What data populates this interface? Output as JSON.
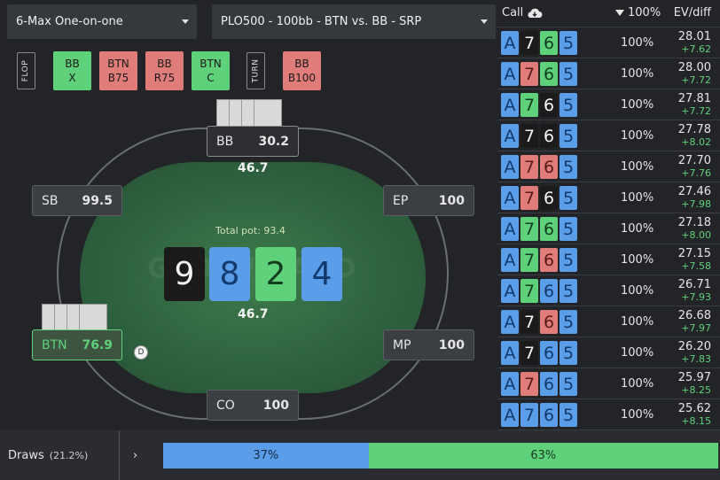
{
  "dropdowns": {
    "format": "6-Max One-on-one",
    "scenario": "PLO500 - 100bb - BTN vs. BB - SRP"
  },
  "actions": {
    "flop_label": "FLOP",
    "turn_label": "TURN",
    "flop_actions": [
      {
        "player": "BB",
        "action": "X",
        "color": "green"
      },
      {
        "player": "BTN",
        "action": "B75",
        "color": "red"
      },
      {
        "player": "BB",
        "action": "R75",
        "color": "red"
      },
      {
        "player": "BTN",
        "action": "C",
        "color": "green"
      }
    ],
    "turn_actions": [
      {
        "player": "BB",
        "action": "B100",
        "color": "red"
      }
    ]
  },
  "table": {
    "total_pot": "Total pot: 93.4",
    "watermark": "GTO WIZARD",
    "bb_bet": "46.7",
    "btn_bet": "46.7",
    "board": [
      {
        "rank": "9",
        "color": "black"
      },
      {
        "rank": "8",
        "color": "blue"
      },
      {
        "rank": "2",
        "color": "green"
      },
      {
        "rank": "4",
        "color": "blue"
      }
    ],
    "seats": {
      "bb": {
        "name": "BB",
        "stack": "30.2"
      },
      "sb": {
        "name": "SB",
        "stack": "99.5"
      },
      "ep": {
        "name": "EP",
        "stack": "100"
      },
      "btn": {
        "name": "BTN",
        "stack": "76.9"
      },
      "mp": {
        "name": "MP",
        "stack": "100"
      },
      "co": {
        "name": "CO",
        "stack": "100"
      }
    },
    "dealer": "D"
  },
  "panel": {
    "header": {
      "action": "Call",
      "sort_label": "100%",
      "ev_label": "EV/diff"
    },
    "rows": [
      {
        "cards": [
          [
            "A",
            "blue"
          ],
          [
            "7",
            "black"
          ],
          [
            "6",
            "green"
          ],
          [
            "5",
            "blue"
          ]
        ],
        "pct": "100%",
        "ev": "28.01",
        "diff": "+7.62"
      },
      {
        "cards": [
          [
            "A",
            "blue"
          ],
          [
            "7",
            "red"
          ],
          [
            "6",
            "green"
          ],
          [
            "5",
            "blue"
          ]
        ],
        "pct": "100%",
        "ev": "28.00",
        "diff": "+7.72"
      },
      {
        "cards": [
          [
            "A",
            "blue"
          ],
          [
            "7",
            "green"
          ],
          [
            "6",
            "black"
          ],
          [
            "5",
            "blue"
          ]
        ],
        "pct": "100%",
        "ev": "27.81",
        "diff": "+7.72"
      },
      {
        "cards": [
          [
            "A",
            "blue"
          ],
          [
            "7",
            "black"
          ],
          [
            "6",
            "black"
          ],
          [
            "5",
            "blue"
          ]
        ],
        "pct": "100%",
        "ev": "27.78",
        "diff": "+8.02"
      },
      {
        "cards": [
          [
            "A",
            "blue"
          ],
          [
            "7",
            "red"
          ],
          [
            "6",
            "red"
          ],
          [
            "5",
            "blue"
          ]
        ],
        "pct": "100%",
        "ev": "27.70",
        "diff": "+7.76"
      },
      {
        "cards": [
          [
            "A",
            "blue"
          ],
          [
            "7",
            "red"
          ],
          [
            "6",
            "black"
          ],
          [
            "5",
            "blue"
          ]
        ],
        "pct": "100%",
        "ev": "27.46",
        "diff": "+7.98"
      },
      {
        "cards": [
          [
            "A",
            "blue"
          ],
          [
            "7",
            "green"
          ],
          [
            "6",
            "green"
          ],
          [
            "5",
            "blue"
          ]
        ],
        "pct": "100%",
        "ev": "27.18",
        "diff": "+8.00"
      },
      {
        "cards": [
          [
            "A",
            "blue"
          ],
          [
            "7",
            "green"
          ],
          [
            "6",
            "red"
          ],
          [
            "5",
            "blue"
          ]
        ],
        "pct": "100%",
        "ev": "27.15",
        "diff": "+7.58"
      },
      {
        "cards": [
          [
            "A",
            "blue"
          ],
          [
            "7",
            "green"
          ],
          [
            "6",
            "blue"
          ],
          [
            "5",
            "blue"
          ]
        ],
        "pct": "100%",
        "ev": "26.71",
        "diff": "+7.93"
      },
      {
        "cards": [
          [
            "A",
            "blue"
          ],
          [
            "7",
            "black"
          ],
          [
            "6",
            "red"
          ],
          [
            "5",
            "blue"
          ]
        ],
        "pct": "100%",
        "ev": "26.68",
        "diff": "+7.97"
      },
      {
        "cards": [
          [
            "A",
            "blue"
          ],
          [
            "7",
            "black"
          ],
          [
            "6",
            "blue"
          ],
          [
            "5",
            "blue"
          ]
        ],
        "pct": "100%",
        "ev": "26.20",
        "diff": "+7.83"
      },
      {
        "cards": [
          [
            "A",
            "blue"
          ],
          [
            "7",
            "red"
          ],
          [
            "6",
            "blue"
          ],
          [
            "5",
            "blue"
          ]
        ],
        "pct": "100%",
        "ev": "25.97",
        "diff": "+8.25"
      },
      {
        "cards": [
          [
            "A",
            "blue"
          ],
          [
            "7",
            "blue"
          ],
          [
            "6",
            "blue"
          ],
          [
            "5",
            "blue"
          ]
        ],
        "pct": "100%",
        "ev": "25.62",
        "diff": "+8.15"
      }
    ]
  },
  "bottom": {
    "label": "Draws",
    "sub": "(21.2%)",
    "chevron_icon": "chevron-right-icon",
    "segments": [
      {
        "label": "37%",
        "fraction": 0.37,
        "color": "blue"
      },
      {
        "label": "63%",
        "fraction": 0.63,
        "color": "green"
      }
    ]
  },
  "colors": {
    "green": "#5ed17a",
    "red": "#e07d7a",
    "blue": "#5a9de8",
    "black": "#1b1b1b",
    "felt": "#2f6340"
  }
}
